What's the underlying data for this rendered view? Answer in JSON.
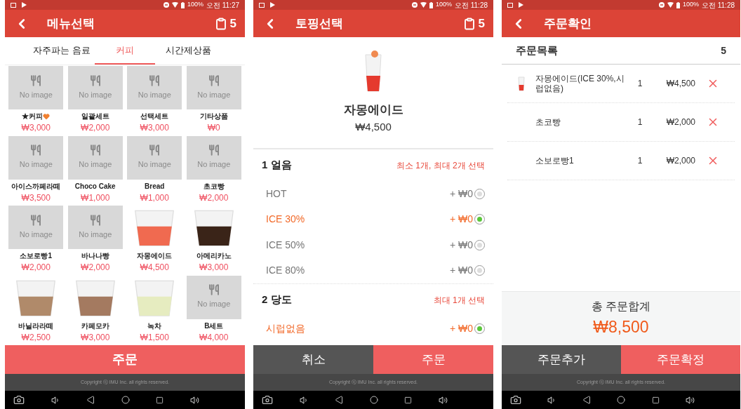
{
  "screens": [
    {
      "kind": "menu",
      "status": {
        "battery": "100%",
        "time": "오전 11:27"
      },
      "header": {
        "title": "메뉴선택",
        "cart_count": "5"
      },
      "tabs": [
        {
          "label": "자주파는 음료",
          "selected": false
        },
        {
          "label": "커피",
          "selected": true
        },
        {
          "label": "시간제상품",
          "selected": false
        }
      ],
      "items": [
        {
          "name": "★커피",
          "heart": true,
          "price": "₩3,000",
          "kind": "placeholder",
          "placeholder": "No image"
        },
        {
          "name": "일괄세트",
          "heart": false,
          "price": "₩2,000",
          "kind": "placeholder",
          "placeholder": "No image"
        },
        {
          "name": "선택세트",
          "heart": false,
          "price": "₩3,000",
          "kind": "placeholder",
          "placeholder": "No image"
        },
        {
          "name": "기타상품",
          "heart": false,
          "price": "₩0",
          "kind": "placeholder",
          "placeholder": "No image"
        },
        {
          "name": "아이스까페라떼",
          "heart": false,
          "price": "₩3,500",
          "kind": "placeholder",
          "placeholder": "No image"
        },
        {
          "name": "Choco Cake",
          "heart": false,
          "price": "₩1,000",
          "kind": "placeholder",
          "placeholder": "No image"
        },
        {
          "name": "Bread",
          "heart": false,
          "price": "₩1,000",
          "kind": "placeholder",
          "placeholder": "No image"
        },
        {
          "name": "초코빵",
          "heart": false,
          "price": "₩2,000",
          "kind": "placeholder",
          "placeholder": "No image"
        },
        {
          "name": "소보로빵1",
          "heart": false,
          "price": "₩2,000",
          "kind": "placeholder",
          "placeholder": "No image"
        },
        {
          "name": "바나나빵",
          "heart": false,
          "price": "₩2,000",
          "kind": "placeholder",
          "placeholder": "No image"
        },
        {
          "name": "자몽에이드",
          "heart": false,
          "price": "₩4,500",
          "kind": "photo"
        },
        {
          "name": "아메리카노",
          "heart": false,
          "price": "₩3,000",
          "kind": "photo"
        },
        {
          "name": "바닐라라떼",
          "heart": false,
          "price": "₩2,500",
          "kind": "photo"
        },
        {
          "name": "카페모카",
          "heart": false,
          "price": "₩3,000",
          "kind": "photo"
        },
        {
          "name": "녹차",
          "heart": false,
          "price": "₩1,500",
          "kind": "photo"
        },
        {
          "name": "B세트",
          "heart": false,
          "price": "₩4,000",
          "kind": "placeholder",
          "placeholder": "No image"
        }
      ],
      "buttons": [
        {
          "label": "주문",
          "kind": "primary"
        }
      ],
      "copyright": "Copyright ⓒ IMU Inc. all rights reserved."
    },
    {
      "kind": "topping",
      "status": {
        "battery": "100%",
        "time": "오전 11:28"
      },
      "header": {
        "title": "토핑선택",
        "cart_count": "5"
      },
      "product": {
        "name": "자몽에이드",
        "price": "₩4,500"
      },
      "groups": [
        {
          "title": "1 얼음",
          "rule": "최소 1개, 최대 2개 선택",
          "options": [
            {
              "label": "HOT",
              "price": "+ ₩0",
              "selected": false
            },
            {
              "label": "ICE 30%",
              "price": "+ ₩0",
              "selected": true
            },
            {
              "label": "ICE 50%",
              "price": "+ ₩0",
              "selected": false
            },
            {
              "label": "ICE 80%",
              "price": "+ ₩0",
              "selected": false
            }
          ]
        },
        {
          "title": "2 당도",
          "rule": "최대 1개 선택",
          "options": [
            {
              "label": "시럽없음",
              "price": "+ ₩0",
              "selected": true
            }
          ]
        }
      ],
      "buttons": [
        {
          "label": "취소",
          "kind": "secondary"
        },
        {
          "label": "주문",
          "kind": "primary"
        }
      ],
      "copyright": "Copyright ⓒ IMU Inc. all rights reserved."
    },
    {
      "kind": "confirm",
      "status": {
        "battery": "100%",
        "time": "오전 11:28"
      },
      "header": {
        "title": "주문확인"
      },
      "list_title": "주문목록",
      "list_count": "5",
      "orders": [
        {
          "name": "자몽에이드(ICE 30%,시럽없음)",
          "qty": "1",
          "price": "₩4,500",
          "thumbnail": true
        },
        {
          "name": "초코빵",
          "qty": "1",
          "price": "₩2,000",
          "thumbnail": false
        },
        {
          "name": "소보로빵1",
          "qty": "1",
          "price": "₩2,000",
          "thumbnail": false
        }
      ],
      "total_label": "총 주문합계",
      "total": "₩8,500",
      "buttons": [
        {
          "label": "주문추가",
          "kind": "secondary"
        },
        {
          "label": "주문확정",
          "kind": "primary"
        }
      ],
      "copyright": "Copyright ⓒ IMU Inc. all rights reserved."
    }
  ]
}
